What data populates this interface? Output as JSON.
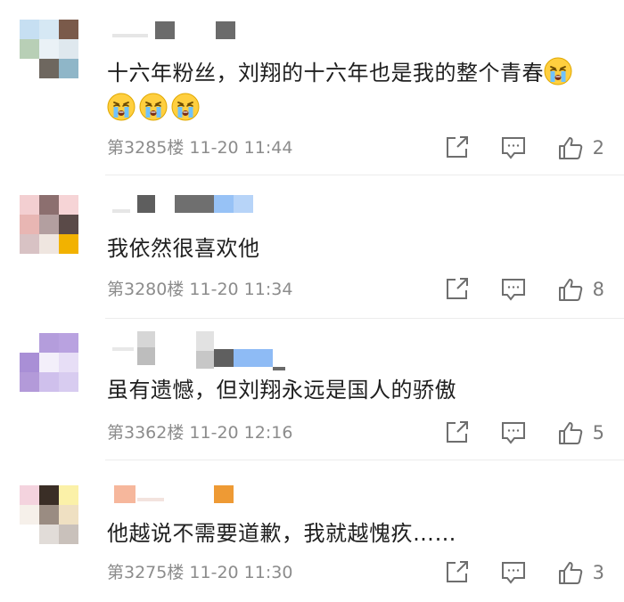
{
  "comments": [
    {
      "text": "十六年粉丝，刘翔的十六年也是我的整个青春",
      "emoji_count": 4,
      "floor": "第3285楼",
      "time": "11-20 11:44",
      "likes": "2"
    },
    {
      "text": "我依然很喜欢他",
      "floor": "第3280楼",
      "time": "11-20 11:34",
      "likes": "8"
    },
    {
      "text": "虽有遗憾，但刘翔永远是国人的骄傲",
      "floor": "第3362楼",
      "time": "11-20 12:16",
      "likes": "5"
    },
    {
      "text": "他越说不需要道歉，我就越愧疚……",
      "floor": "第3275楼",
      "time": "11-20 11:30",
      "likes": "3"
    }
  ],
  "icons": {
    "share": "share-icon",
    "reply": "comment-reply-icon",
    "like": "thumbs-up-icon",
    "emoji": "crying-face-emoji"
  },
  "colors": {
    "icon": "#6e6e6e",
    "meta_text": "#8c8c8c",
    "divider": "#ececec"
  }
}
